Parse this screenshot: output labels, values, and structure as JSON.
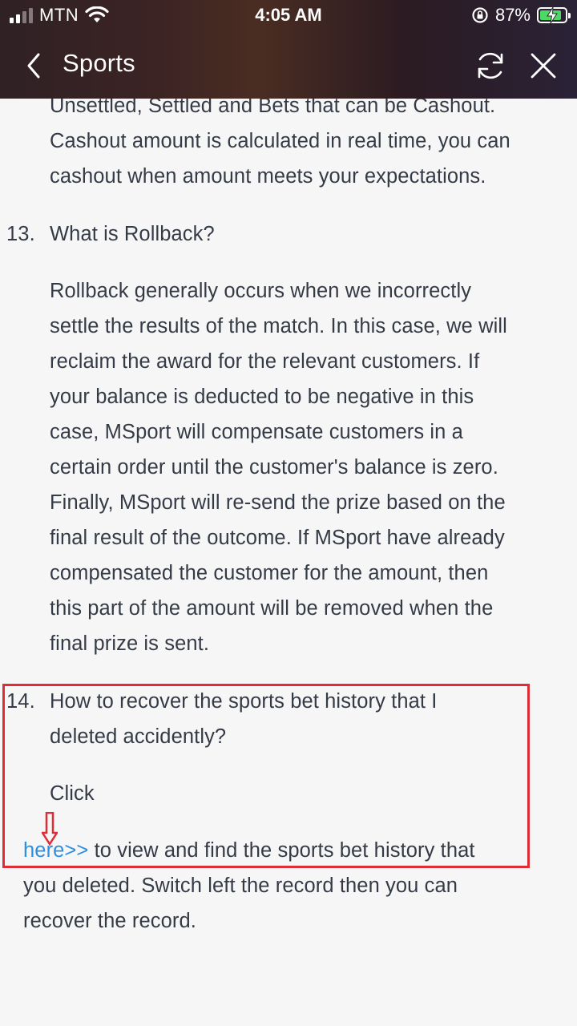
{
  "status_bar": {
    "carrier": "MTN",
    "time": "4:05 AM",
    "battery_percent": "87%"
  },
  "header": {
    "title": "Sports",
    "icons": [
      "back-arrow-icon",
      "refresh-icon",
      "close-icon"
    ]
  },
  "article": {
    "intro_lines": [
      "Unsettled, Settled and Bets that can be Cashout.",
      "Cashout amount is calculated in real time, you can",
      "cashout when amount meets your expectations."
    ],
    "q13": {
      "number": "13.",
      "question": "What is Rollback?",
      "answer_lines": [
        "Rollback generally occurs when we incorrectly",
        "settle the results of the match. In this case, we will",
        "reclaim the award for the relevant customers. If",
        "your balance is deducted to be negative in this",
        "case, MSport will compensate customers in a",
        "certain order until the customer's balance is zero.",
        "Finally, MSport will re-send the prize based on the",
        "final result of the outcome. If MSport have already",
        "compensated the customer for the amount, then",
        "this part of the amount will be removed when the",
        "final prize is sent."
      ]
    },
    "q14": {
      "number": "14.",
      "question_lines": [
        "How to recover the sports bet history that I",
        "deleted accidently?"
      ],
      "click_text": "Click",
      "link_text": "here>>",
      "after_link": " to view and find the sports bet history that",
      "continued_lines": [
        "you deleted. Switch left the record then you can",
        "recover the record."
      ]
    }
  },
  "annotation_color": "#e02c35",
  "link_color": "#2e8fe0"
}
